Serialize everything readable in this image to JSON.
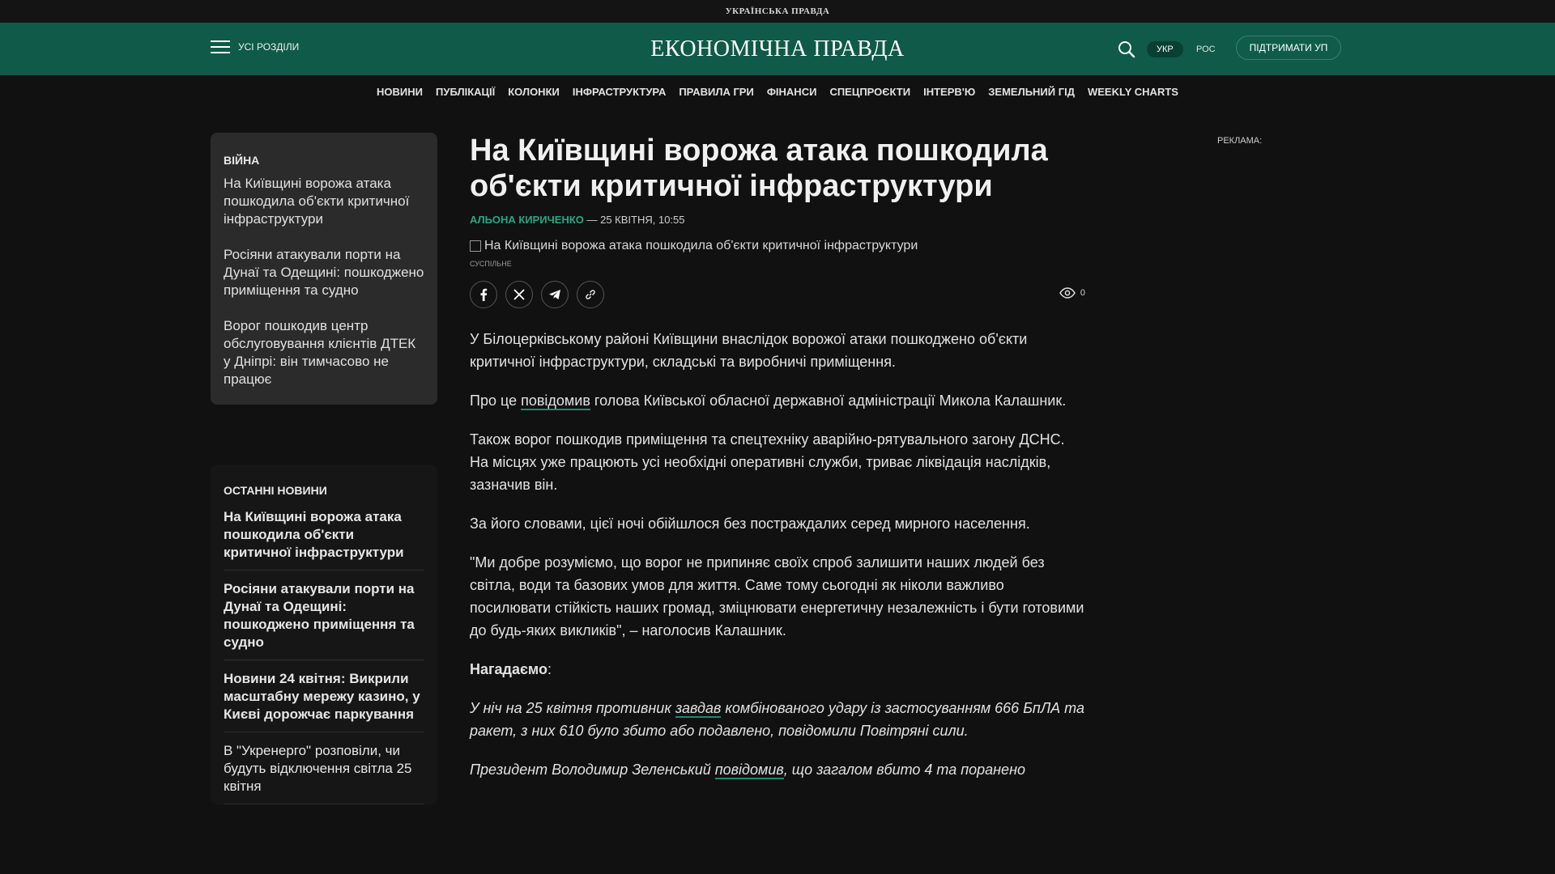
{
  "topbar": {
    "brand": "УКРАЇНСЬКА ПРАВДА"
  },
  "header": {
    "menu_label": "УСІ РОЗДІЛИ",
    "logo": "ЕКОНОМІЧНА ПРАВДА",
    "lang_ukr": "УКР",
    "lang_ros": "РОС",
    "support": "ПІДТРИМАТИ УП",
    "accent": "#0f5a48"
  },
  "nav": {
    "items": [
      {
        "label": "НОВИНИ"
      },
      {
        "label": "ПУБЛІКАЦІЇ"
      },
      {
        "label": "КОЛОНКИ"
      },
      {
        "label": "ІНФРАСТРУКТУРА"
      },
      {
        "label": "ПРАВИЛА ГРИ"
      },
      {
        "label": "ФІНАНСИ"
      },
      {
        "label": "СПЕЦПРОЄКТИ"
      },
      {
        "label": "ІНТЕРВ'Ю"
      },
      {
        "label": "ЗЕМЕЛЬНИЙ ГІД"
      },
      {
        "label": "WEEKLY CHARTS"
      }
    ]
  },
  "sidebar": {
    "war": {
      "heading": "ВІЙНА",
      "items": [
        {
          "title": "На Київщині ворожа атака пошкодила об'єкти критичної інфраструктури"
        },
        {
          "title": "Росіяни атакували порти на Дунаї та Одещині: пошкоджено приміщення та судно"
        },
        {
          "title": "Ворог пошкодив центр обслуговування клієнтів ДТЕК у Дніпрі: він тимчасово не працює"
        }
      ]
    },
    "latest": {
      "heading": "ОСТАННІ НОВИНИ",
      "items": [
        {
          "title": "На Київщині ворожа атака пошкодила об'єкти критичної інфраструктури"
        },
        {
          "title": "Росіяни атакували порти на Дунаї та Одещині: пошкоджено приміщення та судно"
        },
        {
          "title": "Новини 24 квітня: Викрили масштабну мережу казино, у Києві дорожчає паркування"
        },
        {
          "title": "В \"Укренерго\" розповіли, чи будуть відключення світла 25 квітня"
        }
      ]
    }
  },
  "article": {
    "title": "На Київщині ворожа атака пошкодила об'єкти критичної інфраструктури",
    "author": "АЛЬОНА КИРИЧЕНКО",
    "date": " — 25 КВІТНЯ, 10:55",
    "image_alt": "На Київщині ворожа атака пошкодила об'єкти критичної інфраструктури",
    "image_source": "СУСПІЛЬНЕ",
    "views": "0",
    "p1": "У Білоцерківському районі Київщини внаслідок ворожої атаки пошкоджено об'єкти критичної інфраструктури, складські та виробничі приміщення.",
    "p2_a": "Про це ",
    "p2_link": "повідомив",
    "p2_b": " голова Київської обласної державної адміністрації Микола Калашник.",
    "p3": "Також ворог пошкодив приміщення та спецтехніку аварійно-рятувального загону ДСНС. На місцях уже працюють усі необхідні оперативні служби, триває ліквідація наслідків, зазначив він.",
    "p4": "За його словами, цієї ночі обійшлося без постраждалих серед мирного населення.",
    "p5": "\"Ми добре розуміємо, що ворог не припиняє своїх спроб залишити наших людей без світла, води та базових умов для життя. Саме тому сьогодні як ніколи важливо посилювати стійкість наших громад, зміцнювати енергетичну незалежність і бути готовими до будь-яких викликів\", – наголосив Калашник.",
    "remind": "Нагадаємо",
    "remind_colon": ":",
    "p6_a": "У ніч на 25 квітня противник ",
    "p6_link": "завдав",
    "p6_b": " комбінованого удару із застосуванням 666 БпЛА та ракет, з них 610 було збито або подавлено, повідомили Повітряні сили.",
    "p7_a": "Президент Володимир Зеленський ",
    "p7_link": "повідомив",
    "p7_b": ", що загалом вбито 4 та поранено"
  },
  "ad": {
    "label": "РЕКЛАМА:"
  }
}
